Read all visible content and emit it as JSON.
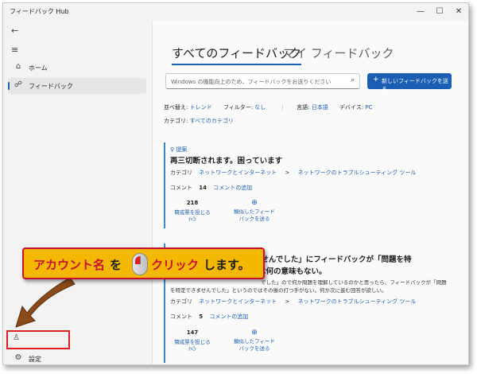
{
  "window": {
    "title": "フィードバック Hub"
  },
  "sidebar": {
    "back_icon": "back-arrow-icon",
    "menu_icon": "hamburger-icon",
    "items": [
      {
        "label": "ホーム",
        "icon": "home-icon"
      },
      {
        "label": "フィードバック",
        "icon": "feedback-icon",
        "active": true
      }
    ],
    "settings_label": "設定"
  },
  "main": {
    "tabs": [
      {
        "label": "すべてのフィードバック"
      },
      {
        "label": "マイ フィードバック"
      }
    ],
    "search_placeholder": "Windows の機能向上のため、フィードバックをお送りください",
    "new_button": "新しいフィードバックを送る",
    "filters": {
      "sort_label": "並べ替え:",
      "sort_value": "トレンド",
      "filter_label": "フィルター:",
      "filter_value": "なし",
      "language_label": "言語:",
      "language_value": "日本語",
      "device_label": "デバイス:",
      "device_value": "PC",
      "category_label": "カテゴリ:",
      "category_value": "すべてのカテゴリ"
    },
    "cards": [
      {
        "tag": "提案",
        "title": "再三切断されます。困っています",
        "category_label": "カテゴリ",
        "category": "ネットワークとインターネット",
        "separator": ">",
        "subcategory": "ネットワークのトラブルシューティング ツール",
        "comments_label": "コメント",
        "comments": "14",
        "add_comment": "コメントの追加",
        "votes": "218",
        "upvote_label": "賛成票を投じる",
        "similar_label_1": "類似したフィード",
        "similar_label_2": "バックを送る"
      },
      {
        "title_line1": "できませんでした」にフィードバックが「問題を特",
        "title_line2": "のでは何の意味もない。",
        "body_line1": "でした」ので何か問題を理解しているのかと思ったら、フィードバックが「問題",
        "body_line2": "を特定できませんでした」というのではその後の打つ手がない。何か次に進む回答が欲しい。",
        "category_label": "カテゴリ",
        "category": "ネットワークとインターネット",
        "separator": ">",
        "subcategory": "ネットワークのトラブルシューティング ツール",
        "comments_label": "コメント",
        "comments": "5",
        "add_comment": "コメントの追加",
        "votes": "147",
        "upvote_label": "賛成票を投じる",
        "similar_label_1": "類似したフィード",
        "similar_label_2": "バックを送る"
      }
    ]
  },
  "callout": {
    "part1": "アカウント名",
    "part2": "を",
    "part3": "クリック",
    "part4": "します。"
  },
  "colors": {
    "accent": "#1a5fb4",
    "callout_bg": "#f5b800",
    "callout_red": "#c8102e",
    "highlight": "#e02020"
  }
}
